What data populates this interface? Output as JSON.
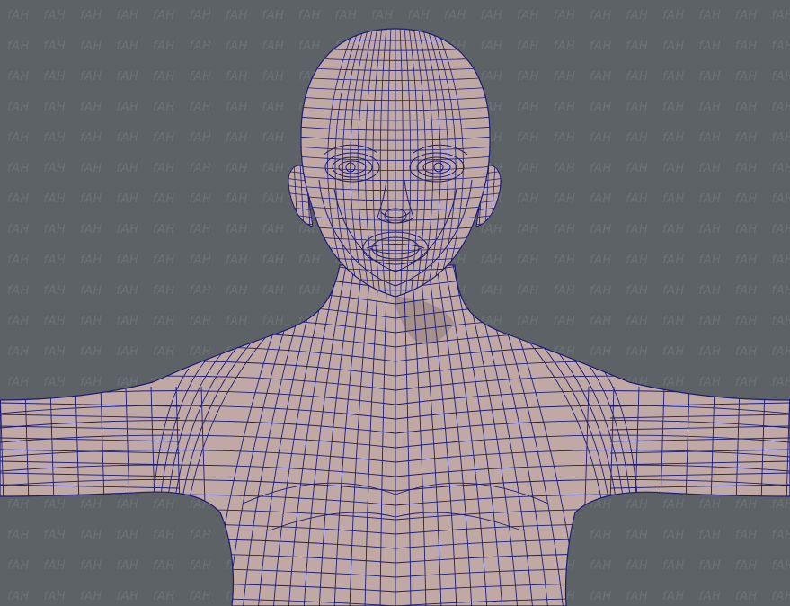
{
  "viewport": {
    "background": "#5d6266",
    "watermark": {
      "text": "fAH",
      "color": "#6c7175"
    }
  },
  "model": {
    "icon": "character-wireframe-mesh",
    "skin_color": "#c0a9a5",
    "skin_shadow": "#9e8a86",
    "wire_color": "#1c1c7a"
  }
}
